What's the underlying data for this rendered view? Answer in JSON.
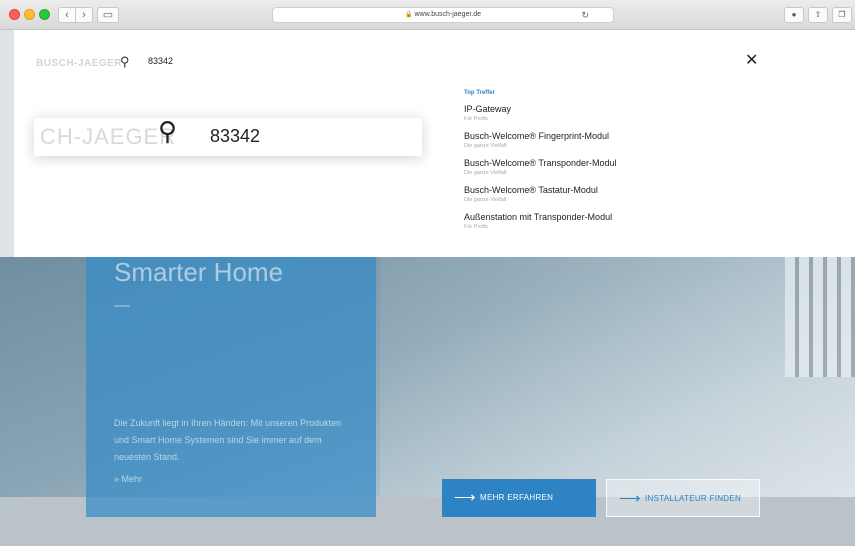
{
  "browser": {
    "url": "www.busch-jaeger.de"
  },
  "search": {
    "query": "83342",
    "ghost_logo_small": "BUSCH-JAEGER",
    "ghost_logo_large": "CH-JAEGER",
    "results_heading": "Top Treffer",
    "results": [
      {
        "title": "IP-Gateway",
        "subtitle": "Für Profis"
      },
      {
        "title": "Busch-Welcome® Fingerprint-Modul",
        "subtitle": "Die ganze Vielfalt"
      },
      {
        "title": "Busch-Welcome® Transponder-Modul",
        "subtitle": "Die ganze Vielfalt"
      },
      {
        "title": "Busch-Welcome® Tastatur-Modul",
        "subtitle": "Die ganze Vielfalt"
      },
      {
        "title": "Außenstation mit Transponder-Modul",
        "subtitle": "Für Profis"
      }
    ]
  },
  "hero": {
    "title": "Smarter Home",
    "dash": "—",
    "description": "Die Zukunft liegt in Ihren Händen: Mit unseren Produkten und Smart Home Systemen sind Sie immer auf dem neuesten Stand.",
    "more_link": "» Mehr",
    "cta_primary": "MEHR ERFAHREN",
    "cta_secondary": "INSTALLATEUR FINDEN"
  },
  "colors": {
    "brand_blue": "#2d83c3"
  },
  "icons": {
    "search": "search-icon",
    "close": "close-icon",
    "arrow": "arrow-right-icon"
  }
}
